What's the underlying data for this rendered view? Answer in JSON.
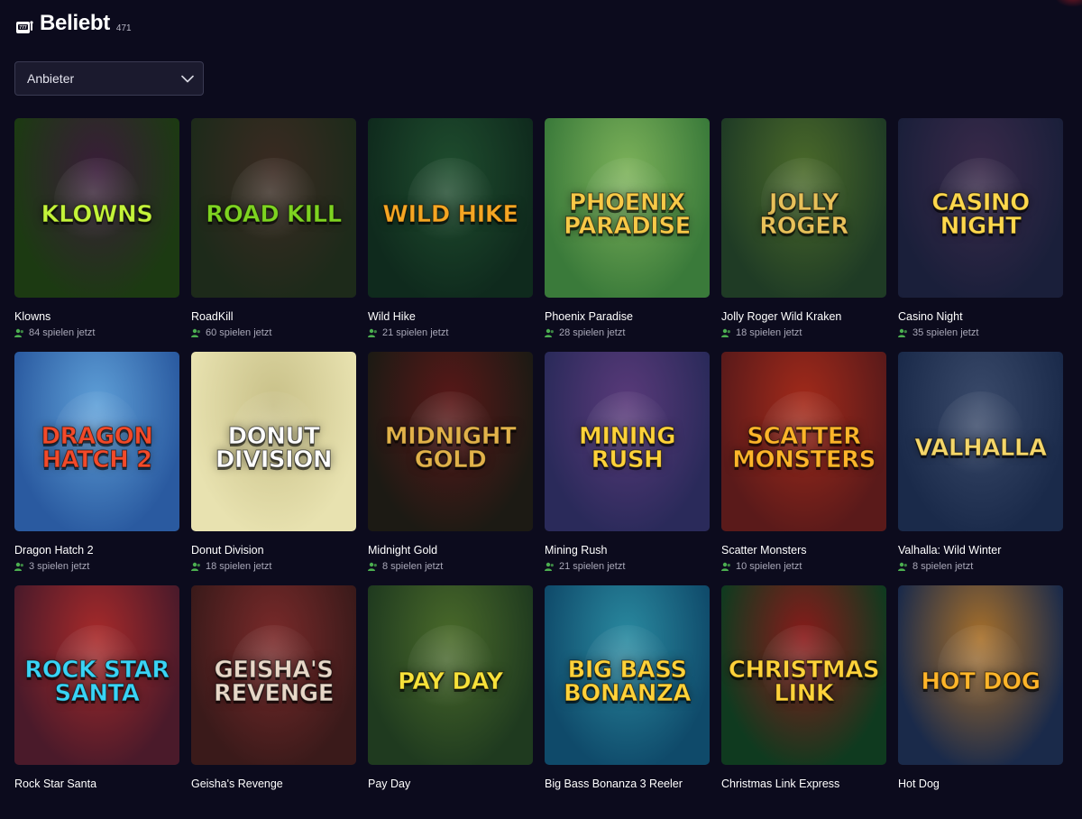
{
  "header": {
    "title": "Beliebt",
    "count": "471",
    "icon": "slot-machine-icon"
  },
  "filter": {
    "label": "Anbieter",
    "icon": "chevron-down-icon"
  },
  "colors": {
    "background": "#0c0b1d",
    "player_icon": "#4caf50"
  },
  "games": [
    {
      "name": "Klowns",
      "players": "84 spielen jetzt",
      "logo": "KLOWNS",
      "c1": "#1c3a12",
      "c2": "#3a1c3a",
      "accent": "#c4f43a"
    },
    {
      "name": "RoadKill",
      "players": "60 spielen jetzt",
      "logo": "ROAD KILL",
      "c1": "#1d2a1a",
      "c2": "#3b2a22",
      "accent": "#7ed321"
    },
    {
      "name": "Wild Hike",
      "players": "21 spielen jetzt",
      "logo": "WILD HIKE",
      "c1": "#0f2a1d",
      "c2": "#1f4d2e",
      "accent": "#f5a623"
    },
    {
      "name": "Phoenix Paradise",
      "players": "28 spielen jetzt",
      "logo": "PHOENIX PARADISE",
      "c1": "#3a7a3a",
      "c2": "#7db25a",
      "accent": "#f7c948"
    },
    {
      "name": "Jolly Roger Wild Kraken",
      "players": "18 spielen jetzt",
      "logo": "JOLLY ROGER",
      "c1": "#1f3b25",
      "c2": "#4b6a2a",
      "accent": "#e8c15a"
    },
    {
      "name": "Casino Night",
      "players": "35 spielen jetzt",
      "logo": "CASINO NIGHT",
      "c1": "#1a1f3a",
      "c2": "#3a2a4a",
      "accent": "#ffd84d"
    },
    {
      "name": "Dragon Hatch 2",
      "players": "3 spielen jetzt",
      "logo": "DRAGON HATCH 2",
      "c1": "#2a5aa0",
      "c2": "#5fa0d8",
      "accent": "#f24a2a"
    },
    {
      "name": "Donut Division",
      "players": "18 spielen jetzt",
      "logo": "DONUT DIVISION",
      "c1": "#e8e2b0",
      "c2": "#c8c088",
      "accent": "#ffffff"
    },
    {
      "name": "Midnight Gold",
      "players": "8 spielen jetzt",
      "logo": "MIDNIGHT GOLD",
      "c1": "#1c1a14",
      "c2": "#5a1818",
      "accent": "#e2b24a"
    },
    {
      "name": "Mining Rush",
      "players": "21 spielen jetzt",
      "logo": "MINING RUSH",
      "c1": "#2a2a5a",
      "c2": "#5a3a7a",
      "accent": "#ffd23a"
    },
    {
      "name": "Scatter Monsters",
      "players": "10 spielen jetzt",
      "logo": "SCATTER MONSTERS",
      "c1": "#5a1a1a",
      "c2": "#a32a1a",
      "accent": "#ffb52a"
    },
    {
      "name": "Valhalla: Wild Winter",
      "players": "8 spielen jetzt",
      "logo": "VALHALLA",
      "c1": "#1a2a4a",
      "c2": "#3a4a6a",
      "accent": "#f5d76a"
    },
    {
      "name": "Rock Star Santa",
      "players": "",
      "logo": "ROCK STAR SANTA",
      "c1": "#4a1a2a",
      "c2": "#a82a2a",
      "accent": "#3ad3f5"
    },
    {
      "name": "Geisha's Revenge",
      "players": "",
      "logo": "GEISHA'S REVENGE",
      "c1": "#3a1a1a",
      "c2": "#7a2a2a",
      "accent": "#e8d8c8"
    },
    {
      "name": "Pay Day",
      "players": "",
      "logo": "PAY DAY",
      "c1": "#1f3a1f",
      "c2": "#4a6a2a",
      "accent": "#f7e23a"
    },
    {
      "name": "Big Bass Bonanza 3 Reeler",
      "players": "",
      "logo": "BIG BASS BONANZA",
      "c1": "#0f4a6a",
      "c2": "#2a8aa0",
      "accent": "#ffd23a"
    },
    {
      "name": "Christmas Link Express",
      "players": "",
      "logo": "CHRISTMAS LINK",
      "c1": "#0f3a1f",
      "c2": "#8a1a1a",
      "accent": "#ffd23a"
    },
    {
      "name": "Hot Dog",
      "players": "",
      "logo": "HOT DOG",
      "c1": "#1a2a4a",
      "c2": "#a8702a",
      "accent": "#ffb52a"
    }
  ]
}
